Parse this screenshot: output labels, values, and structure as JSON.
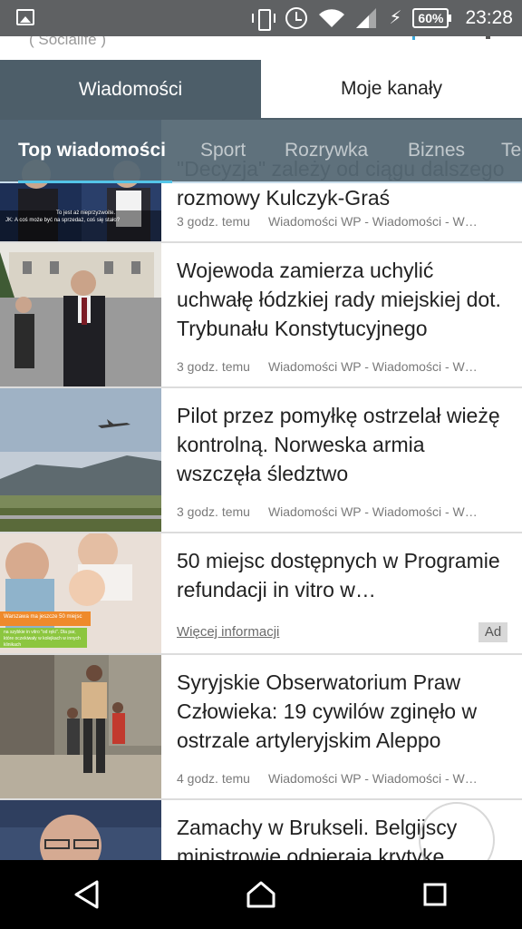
{
  "status_bar": {
    "battery": "60%",
    "time": "23:28"
  },
  "header": {
    "subtitle": "( Socialife )"
  },
  "main_tabs": [
    {
      "label": "Wiadomości"
    },
    {
      "label": "Moje kanały"
    }
  ],
  "categories": [
    {
      "label": "Top wiadomości"
    },
    {
      "label": "Sport"
    },
    {
      "label": "Rozrywka"
    },
    {
      "label": "Biznes"
    },
    {
      "label": "Te"
    }
  ],
  "articles": [
    {
      "title": "\"Decyzja\" zależy od ciągu dalszego rozmowy Kulczyk-Graś",
      "time": "3 godz. temu",
      "source": "Wiadomości WP - Wiadomości - W…"
    },
    {
      "title": "Wojewoda zamierza uchylić uchwałę łódzkiej rady miejskiej dot. Trybunału Konstytucyjnego",
      "time": "3 godz. temu",
      "source": "Wiadomości WP - Wiadomości - W…"
    },
    {
      "title": "Pilot przez pomyłkę ostrzelał wieżę kontrolną. Norweska armia wszczęła śledztwo",
      "time": "3 godz. temu",
      "source": "Wiadomości WP - Wiadomości - W…"
    },
    {
      "title": "50 miejsc dostępnych w Programie refundacji in vitro w…",
      "link": "Więcej informacji",
      "badge": "Ad"
    },
    {
      "title": "Syryjskie Obserwatorium Praw Człowieka: 19 cywilów zginęło w ostrzale artyleryjskim Aleppo",
      "time": "4 godz. temu",
      "source": "Wiadomości WP - Wiadomości - W…"
    },
    {
      "title": "Zamachy w Brukseli. Belgijscy ministrowie odpierają krytykę"
    }
  ],
  "thumb_text": {
    "caption1": "To jest aż nieprzyzwoite.",
    "caption2": "JK: A coś może być na sprzedaż, coś się stało?",
    "ad_line1": "Warszawa ma jeszcze 50 miejsc",
    "ad_line2": "na szybkie in vitro \"od ręki\". Dla par, które oczekiwały w kolejkach w innych klinikach"
  },
  "colors": {
    "status_bar": "#5f6163",
    "tabs_bg": "#4d5e69",
    "category_bar": "#566874",
    "indicator": "#54c5e8"
  },
  "icons": [
    "gallery-icon",
    "vibrate-icon",
    "alarm-icon",
    "wifi-icon",
    "signal-icon",
    "charging-icon",
    "battery-icon",
    "back-icon",
    "home-icon",
    "recents-icon"
  ]
}
